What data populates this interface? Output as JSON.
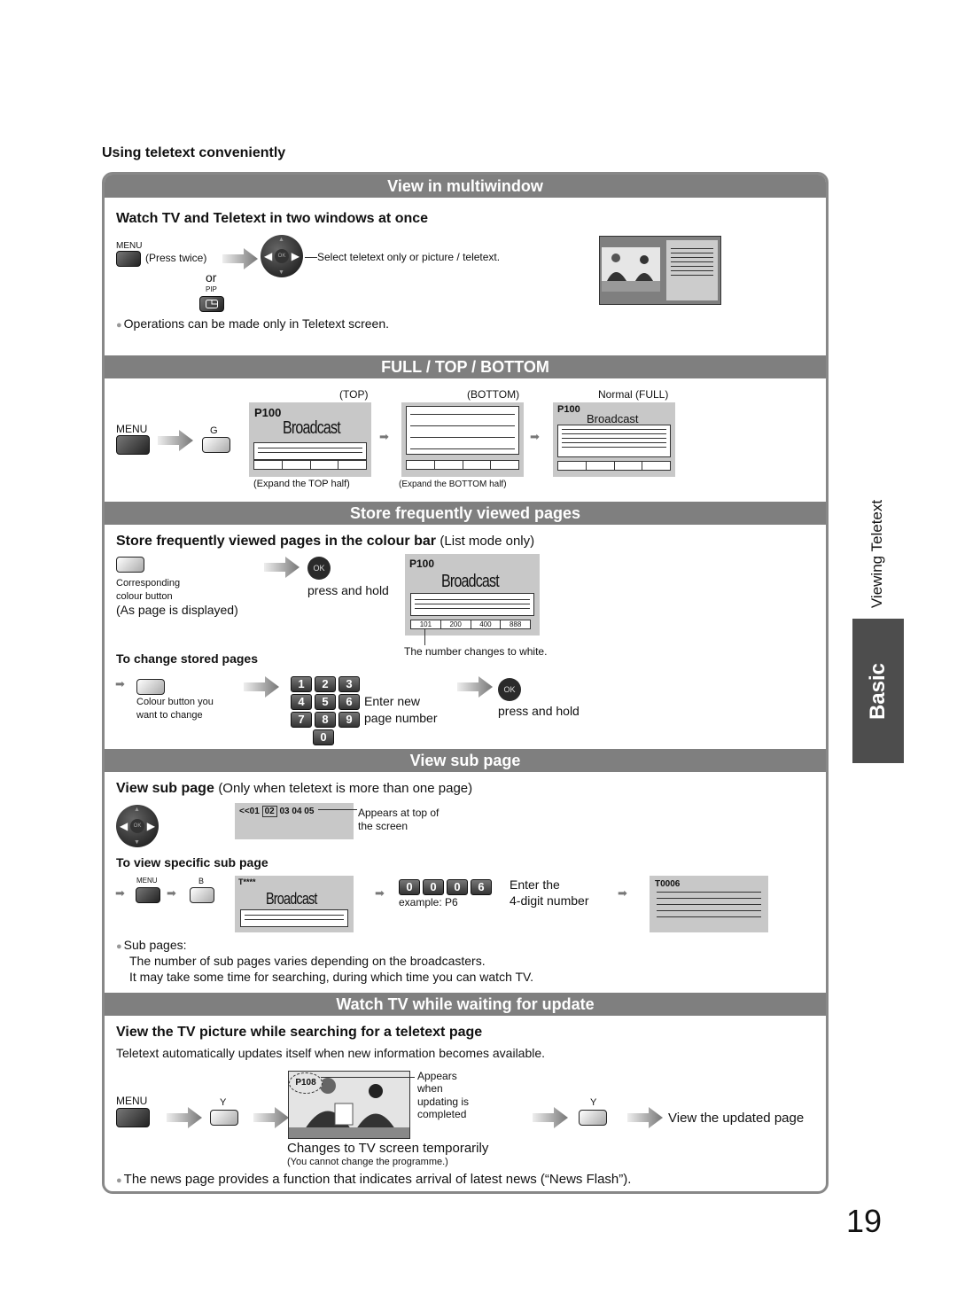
{
  "page_heading": "Using teletext conveniently",
  "side": {
    "title": "Viewing Teletext",
    "tab": "Basic"
  },
  "page_number": "19",
  "s1": {
    "band": "View in multiwindow",
    "subtitle": "Watch TV and Teletext in two windows at once",
    "menu_label": "MENU",
    "press_twice": "(Press twice)",
    "or": "or",
    "pip_label": "PIP",
    "ok": "OK",
    "select_note": "Select teletext only or picture / teletext.",
    "bullet": "Operations can be made only in Teletext screen."
  },
  "s2": {
    "band": "FULL / TOP / BOTTOM",
    "menu_label": "MENU",
    "g_label": "G",
    "top_label": "(TOP)",
    "bottom_label": "(BOTTOM)",
    "full_label": "Normal (FULL)",
    "page": "P100",
    "broadcast": "Broadcast",
    "top_caption": "(Expand the TOP half)",
    "bottom_caption": "(Expand the BOTTOM half)"
  },
  "s3": {
    "band": "Store frequently viewed pages",
    "subtitle": "Store frequently viewed pages in the colour bar",
    "subtitle_note": "(List mode only)",
    "colour_button_1": "Corresponding",
    "colour_button_2": "colour button",
    "as_displayed": "(As page is displayed)",
    "ok": "OK",
    "press_hold": "press and hold",
    "page": "P100",
    "broadcast": "Broadcast",
    "bar_values": [
      "101",
      "200",
      "400",
      "888"
    ],
    "number_note": "The number changes to white.",
    "change_heading": "To change stored pages",
    "change_btn_1": "Colour button you",
    "change_btn_2": "want to change",
    "keypad": [
      "1",
      "2",
      "3",
      "4",
      "5",
      "6",
      "7",
      "8",
      "9",
      "0"
    ],
    "enter_new": "Enter new",
    "page_number": "page number",
    "press_hold_2": "press and hold"
  },
  "s4": {
    "band": "View sub page",
    "subtitle": "View sub page",
    "subtitle_note": "(Only when teletext is more than one page)",
    "ok": "OK",
    "sub_prefix": "<<01",
    "sub_current": "02",
    "sub_rest": "03 04 05",
    "appears_1": "Appears at top of",
    "appears_2": "the screen",
    "specific_heading": "To view specific sub page",
    "menu_label": "MENU",
    "b_label": "B",
    "t_page": "T****",
    "broadcast": "Broadcast",
    "digits": [
      "0",
      "0",
      "0",
      "6"
    ],
    "example": "example: P6",
    "enter_1": "Enter the",
    "enter_2": "4-digit number",
    "result_page": "T0006",
    "bullet": "Sub pages:",
    "note_1": "The number of sub pages varies depending on the broadcasters.",
    "note_2": "It may take some time for searching, during which time you can watch TV."
  },
  "s5": {
    "band": "Watch TV while waiting for update",
    "subtitle": "View the TV picture while searching for a teletext page",
    "desc": "Teletext automatically updates itself when new information becomes available.",
    "menu_label": "MENU",
    "y_label": "Y",
    "p_badge": "P108",
    "appears_1": "Appears",
    "appears_2": "when",
    "appears_3": "updating is",
    "appears_4": "completed",
    "changes": "Changes to TV screen temporarily",
    "cannot": "(You cannot change the programme.)",
    "y_label_2": "Y",
    "view_updated": "View the updated page",
    "bullet": "The news page provides a function that indicates arrival of latest news (“News Flash”)."
  }
}
